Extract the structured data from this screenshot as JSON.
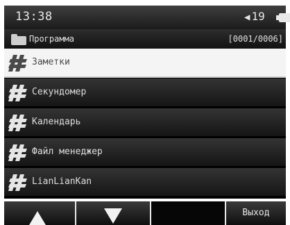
{
  "status": {
    "time": "13:38",
    "volume": "19",
    "icons": {
      "speaker": "speaker-icon",
      "battery": "battery-icon"
    }
  },
  "path": {
    "title": "Программа",
    "counter": "[0001/0006]",
    "icon": "folder-icon"
  },
  "list": {
    "items": [
      {
        "label": "Заметки",
        "selected": true,
        "icon": "app-icon"
      },
      {
        "label": "Секундомер",
        "selected": false,
        "icon": "app-icon"
      },
      {
        "label": "Календарь",
        "selected": false,
        "icon": "app-icon"
      },
      {
        "label": "Файл менеджер",
        "selected": false,
        "icon": "app-icon"
      },
      {
        "label": "LianLianKan",
        "selected": false,
        "icon": "app-icon"
      }
    ]
  },
  "softkeys": {
    "up_icon": "arrow-up-icon",
    "down_icon": "arrow-down-icon",
    "exit_label": "Выход"
  },
  "colors": {
    "selected_row": "#f4f4f4",
    "row_dark": "#1f1f1f",
    "text_light": "#dedede"
  }
}
